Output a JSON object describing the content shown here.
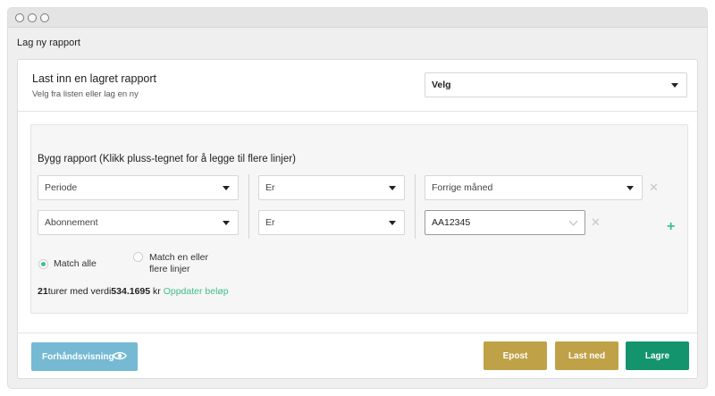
{
  "window": {
    "title": "Lag ny rapport"
  },
  "load_section": {
    "title": "Last inn en lagret rapport",
    "subtitle": "Velg fra listen eller lag en ny",
    "select_value": "Velg"
  },
  "builder": {
    "title": "Bygg rapport (Klikk pluss-tegnet for å legge til flere linjer)",
    "rows": [
      {
        "field": "Periode",
        "operator": "Er",
        "value": "Forrige måned"
      },
      {
        "field": "Abonnement",
        "operator": "Er",
        "value": "AA12345"
      }
    ],
    "match_options": [
      {
        "label": "Match alle",
        "selected": true
      },
      {
        "label": "Match en eller flere linjer",
        "selected": false
      }
    ],
    "summary": {
      "count": "21",
      "count_text": "turer med verdi",
      "amount": "534.1695",
      "currency": " kr",
      "update_link": "Oppdater beløp"
    }
  },
  "footer": {
    "preview_label": "Forhåndsvisning",
    "email_label": "Epost",
    "download_label": "Last ned",
    "save_label": "Lagre"
  },
  "colors": {
    "accent_green": "#3fbf8a",
    "gold": "#bfa147",
    "dark_green": "#13946d",
    "preview_blue": "#76b9d3"
  },
  "icons": [
    "close-icon",
    "plus-icon",
    "eye-icon",
    "chevron-down-icon",
    "caret-down-icon"
  ]
}
